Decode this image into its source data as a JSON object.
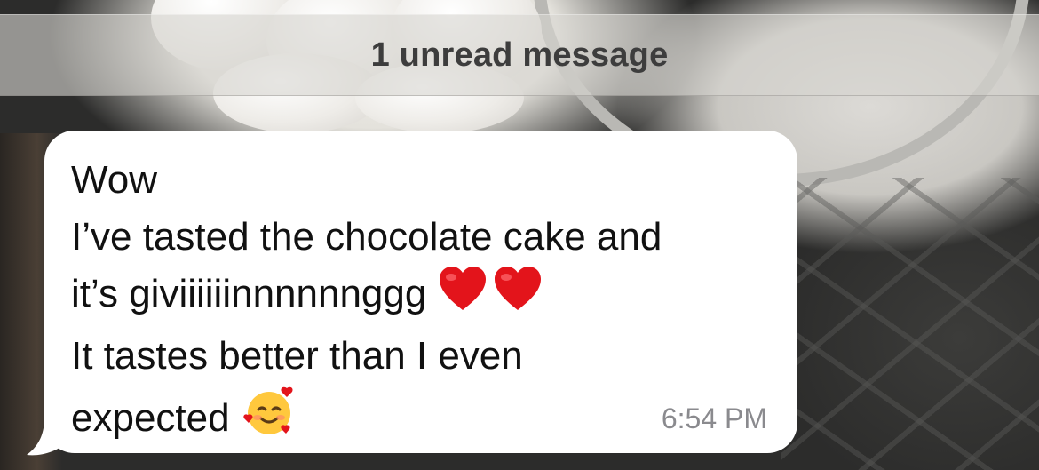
{
  "banner": {
    "label": "1 unread message"
  },
  "message": {
    "lines": [
      "Wow",
      "I’ve tasted the chocolate cake and",
      "it’s giviiiiiinnnnnnggg",
      "It tastes better than I even",
      "expected"
    ],
    "line3_emojis": [
      "red-heart-icon",
      "red-heart-icon"
    ],
    "line5_emoji": "smiling-face-with-hearts-icon",
    "time": "6:54 PM"
  },
  "colors": {
    "bubble": "#ffffff",
    "banner_text": "#3d3d3d",
    "timestamp": "#8a8a8e",
    "heart": "#e3141b"
  }
}
